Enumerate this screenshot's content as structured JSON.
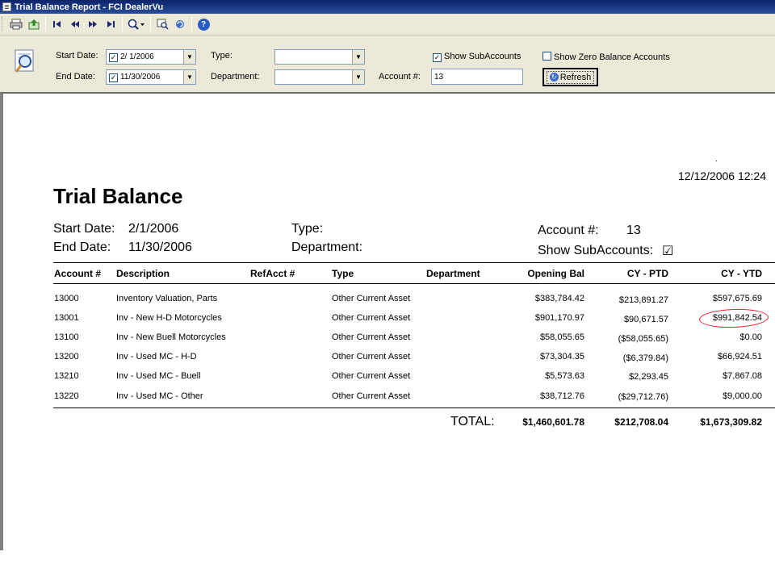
{
  "window": {
    "title": "Trial Balance Report - FCI DealerVu"
  },
  "toolbar": {
    "icons": [
      "print-icon",
      "export-icon",
      "first-page-icon",
      "previous-page-icon",
      "next-page-icon",
      "last-page-icon",
      "zoom-icon",
      "search-icon",
      "refresh-icon",
      "help-icon"
    ]
  },
  "params": {
    "start_date_label": "Start Date:",
    "start_date_value": "2/ 1/2006",
    "end_date_label": "End Date:",
    "end_date_value": "11/30/2006",
    "type_label": "Type:",
    "type_value": "",
    "department_label": "Department:",
    "department_value": "",
    "account_label": "Account #:",
    "account_value": "13",
    "show_sub_label": "Show SubAccounts",
    "show_sub_checked": true,
    "show_zero_label": "Show Zero Balance Accounts",
    "show_zero_checked": false,
    "refresh_label": "Refresh"
  },
  "report": {
    "dot": ".",
    "timestamp": "12/12/2006   12:24",
    "title": "Trial Balance",
    "start_date_label": "Start Date:",
    "start_date": "2/1/2006",
    "end_date_label": "End Date:",
    "end_date": "11/30/2006",
    "type_label": "Type:",
    "department_label": "Department:",
    "account_label": "Account #:",
    "account": "13",
    "show_sub_label": "Show SubAccounts:",
    "show_sub_mark": "☑",
    "columns": {
      "account": "Account #",
      "description": "Description",
      "refacct": "RefAcct #",
      "type": "Type",
      "department": "Department",
      "opening": "Opening Bal",
      "ptd": "CY - PTD",
      "ytd": "CY - YTD"
    },
    "rows": [
      {
        "account": "13000",
        "description": "Inventory Valuation, Parts",
        "type": "Other Current Asset",
        "opening": "$383,784.42",
        "ptd": "$213,891.27",
        "ytd": "$597,675.69"
      },
      {
        "account": "13001",
        "description": "Inv - New H-D Motorcycles",
        "type": "Other Current Asset",
        "opening": "$901,170.97",
        "ptd": "$90,671.57",
        "ytd": "$991,842.54"
      },
      {
        "account": "13100",
        "description": "Inv - New Buell Motorcycles",
        "type": "Other Current Asset",
        "opening": "$58,055.65",
        "ptd": "($58,055.65)",
        "ytd": "$0.00"
      },
      {
        "account": "13200",
        "description": "Inv - Used MC - H-D",
        "type": "Other Current Asset",
        "opening": "$73,304.35",
        "ptd": "($6,379.84)",
        "ytd": "$66,924.51"
      },
      {
        "account": "13210",
        "description": "Inv - Used MC - Buell",
        "type": "Other Current Asset",
        "opening": "$5,573.63",
        "ptd": "$2,293.45",
        "ytd": "$7,867.08"
      },
      {
        "account": "13220",
        "description": "Inv - Used MC - Other",
        "type": "Other Current Asset",
        "opening": "$38,712.76",
        "ptd": "($29,712.76)",
        "ytd": "$9,000.00"
      }
    ],
    "total_label": "TOTAL:",
    "total_opening": "$1,460,601.78",
    "total_ptd": "$212,708.04",
    "total_ytd": "$1,673,309.82",
    "highlight_color": "#e0202a"
  }
}
